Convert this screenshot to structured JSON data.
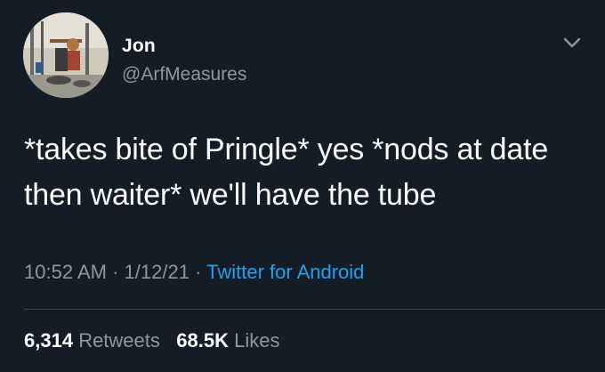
{
  "user": {
    "display_name": "Jon",
    "handle": "@ArfMeasures"
  },
  "tweet": {
    "text": "*takes bite of Pringle* yes *nods at date then waiter* we'll have the tube",
    "time": "10:52 AM",
    "separator": "·",
    "date": "1/12/21",
    "source": "Twitter for Android"
  },
  "stats": {
    "retweets_count": "6,314",
    "retweets_label": "Retweets",
    "likes_count": "68.5K",
    "likes_label": "Likes"
  },
  "icons": {
    "more": "chevron-down-icon",
    "avatar": "avatar"
  },
  "colors": {
    "background": "#141d26",
    "text_primary": "#ffffff",
    "text_secondary": "#8899a6",
    "link": "#1da1f2",
    "divider": "#38444d"
  }
}
